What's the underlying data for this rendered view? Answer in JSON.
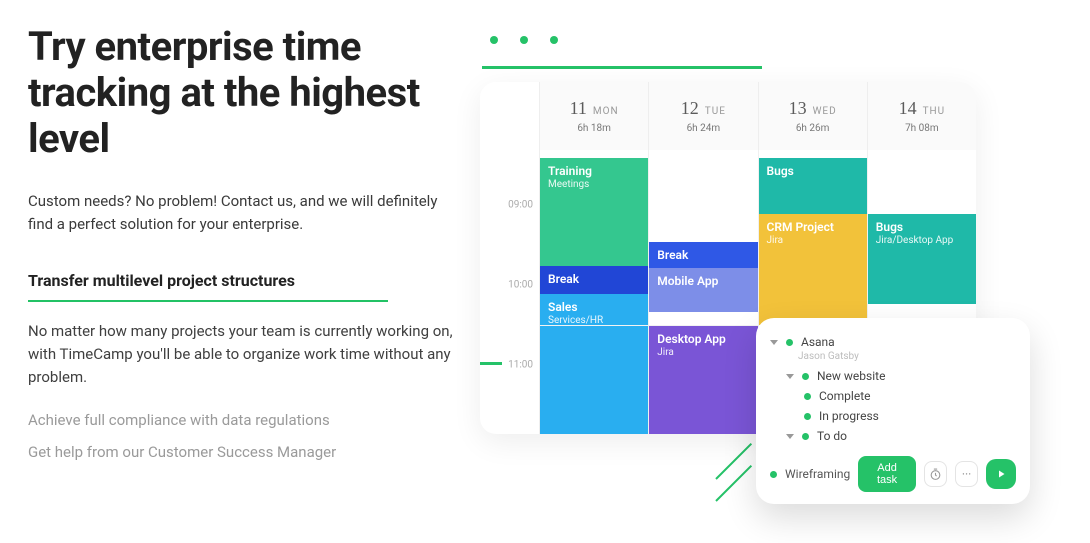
{
  "headline": "Try enterprise time tracking at the highest level",
  "subhead": "Custom needs? No problem! Contact us, and we will definitely find a perfect solution for your enterprise.",
  "feature_active_title": "Transfer multilevel project structures",
  "feature_active_desc": "No matter how many projects your team is currently working on, with TimeCamp you'll be able to organize work time without any problem.",
  "feature_dim_1": "Achieve full compliance with data regulations",
  "feature_dim_2": "Get help from our Customer Success Manager",
  "calendar": {
    "time_labels": {
      "t1": "09:00",
      "t2": "10:00",
      "t3": "11:00"
    },
    "days": [
      {
        "num": "11",
        "name": "MON",
        "dur": "6h 18m"
      },
      {
        "num": "12",
        "name": "TUE",
        "dur": "6h 24m"
      },
      {
        "num": "13",
        "name": "WED",
        "dur": "6h 26m"
      },
      {
        "num": "14",
        "name": "THU",
        "dur": "7h 08m"
      }
    ],
    "events": {
      "d1_train_t": "Training",
      "d1_train_s": "Meetings",
      "d1_break_t": "Break",
      "d1_sales_t": "Sales",
      "d1_sales_s": "Services/HR",
      "d2_break_t": "Break",
      "d2_mobile_t": "Mobile App",
      "d2_desk_t": "Desktop App",
      "d2_desk_s": "Jira",
      "d3_bugs_t": "Bugs",
      "d3_crm_t": "CRM Project",
      "d3_crm_s": "Jira",
      "d4_bugs_t": "Bugs",
      "d4_bugs_s": "Jira/Desktop App"
    }
  },
  "popover": {
    "project": "Asana",
    "owner": "Jason Gatsby",
    "group": "New website",
    "status_complete": "Complete",
    "status_inprogress": "In progress",
    "todo": "To do",
    "wireframing": "Wireframing",
    "add_task": "Add task",
    "more": "···"
  }
}
